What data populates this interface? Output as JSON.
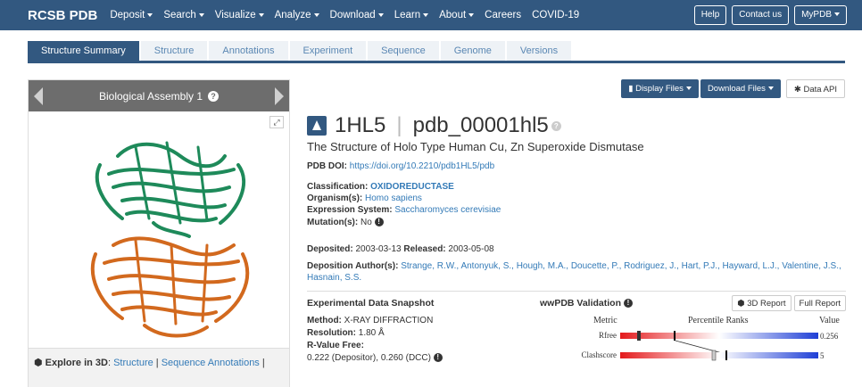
{
  "nav": {
    "brand": "RCSB PDB",
    "items": [
      "Deposit",
      "Search",
      "Visualize",
      "Analyze",
      "Download",
      "Learn",
      "About",
      "Careers",
      "COVID-19"
    ],
    "has_caret": [
      true,
      true,
      true,
      true,
      true,
      true,
      true,
      false,
      false
    ],
    "help": "Help",
    "contact": "Contact us",
    "mypdb": "MyPDB"
  },
  "tabs": [
    "Structure Summary",
    "Structure",
    "Annotations",
    "Experiment",
    "Sequence",
    "Genome",
    "Versions"
  ],
  "viewer": {
    "title": "Biological Assembly 1",
    "explore_label": "Explore in 3D",
    "explore_links": [
      "Structure",
      "Sequence Annotations"
    ]
  },
  "file_buttons": {
    "display": "Display Files",
    "download": "Download Files",
    "api": "Data API"
  },
  "entry": {
    "id": "1HL5",
    "pdb_id": "pdb_00001hl5",
    "title": "The Structure of Holo Type Human Cu, Zn Superoxide Dismutase",
    "doi_label": "PDB DOI:",
    "doi": "https://doi.org/10.2210/pdb1HL5/pdb",
    "classification_label": "Classification:",
    "classification": "OXIDOREDUCTASE",
    "organism_label": "Organism(s):",
    "organism": "Homo sapiens",
    "expression_label": "Expression System:",
    "expression": "Saccharomyces cerevisiae",
    "mutation_label": "Mutation(s):",
    "mutation": "No",
    "deposited_label": "Deposited:",
    "deposited": "2003-03-13",
    "released_label": "Released:",
    "released": "2003-05-08",
    "authors_label": "Deposition Author(s):",
    "authors": "Strange, R.W., Antonyuk, S., Hough, M.A., Doucette, P., Rodriguez, J., Hart, P.J., Hayward, L.J., Valentine, J.S., Hasnain, S.S."
  },
  "snapshot": {
    "title": "Experimental Data Snapshot",
    "method_label": "Method:",
    "method": "X-RAY DIFFRACTION",
    "resolution_label": "Resolution:",
    "resolution": "1.80 Å",
    "rfree_label": "R-Value Free:",
    "rfree": "0.222 (Depositor), 0.260 (DCC)"
  },
  "validation": {
    "title": "wwPDB Validation",
    "btn_3d": "3D Report",
    "btn_full": "Full Report",
    "col_metric": "Metric",
    "col_ranks": "Percentile Ranks",
    "col_value": "Value",
    "rows": [
      {
        "metric": "Rfree",
        "value": "0.256"
      },
      {
        "metric": "Clashscore",
        "value": "5"
      }
    ]
  },
  "colors": {
    "nav_bg": "#325880",
    "link": "#337ab7",
    "helix_green": "#1e8a5a",
    "helix_orange": "#d2691e"
  }
}
